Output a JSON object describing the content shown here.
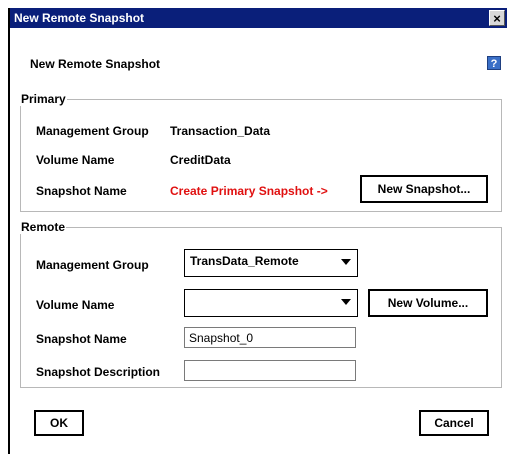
{
  "window": {
    "title": "New Remote Snapshot"
  },
  "heading": "New Remote Snapshot",
  "help_icon": "?",
  "close_icon": "×",
  "primary": {
    "legend": "Primary",
    "management_group_label": "Management Group",
    "management_group_value": "Transaction_Data",
    "volume_name_label": "Volume Name",
    "volume_name_value": "CreditData",
    "snapshot_name_label": "Snapshot Name",
    "snapshot_name_value": "Create Primary Snapshot ->",
    "new_snapshot_button": "New Snapshot..."
  },
  "remote": {
    "legend": "Remote",
    "management_group_label": "Management Group",
    "management_group_selected": "TransData_Remote",
    "volume_name_label": "Volume Name",
    "volume_name_selected": "",
    "new_volume_button": "New Volume...",
    "snapshot_name_label": "Snapshot Name",
    "snapshot_name_value": "Snapshot_0",
    "snapshot_description_label": "Snapshot Description",
    "snapshot_description_value": ""
  },
  "buttons": {
    "ok": "OK",
    "cancel": "Cancel"
  },
  "colors": {
    "title_bar": "#0a1f7a",
    "warning_text": "#e01010",
    "help_icon": "#3a6fc7"
  }
}
